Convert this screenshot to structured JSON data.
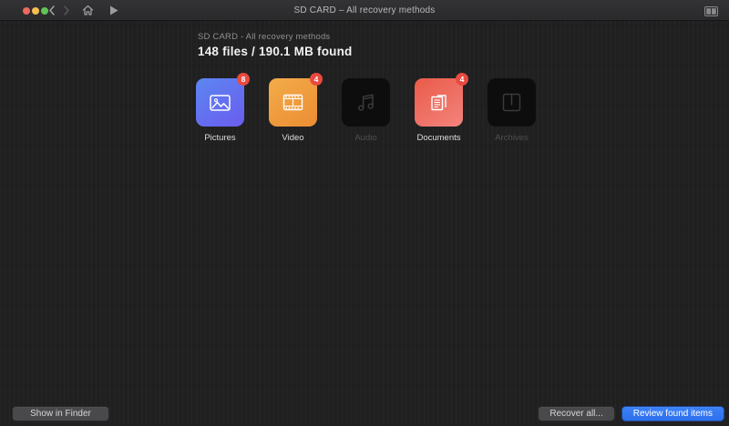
{
  "titlebar": {
    "title": "SD CARD – All recovery methods",
    "icons": [
      "traffic-light-close",
      "traffic-light-minimize",
      "traffic-light-zoom",
      "back-chevron",
      "forward-chevron",
      "home",
      "play",
      "panel-toggle"
    ]
  },
  "header": {
    "subtitle": "SD CARD - All recovery methods",
    "title": "148 files / 190.1 MB found"
  },
  "categories": [
    {
      "label": "Pictures",
      "badge": "8",
      "enabled": true,
      "icon": "pictures-icon",
      "color_top": "#5c86f1",
      "color_bottom": "#6a5def"
    },
    {
      "label": "Video",
      "badge": "4",
      "enabled": true,
      "icon": "film-icon",
      "color_top": "#f3ac49",
      "color_bottom": "#eb8d33"
    },
    {
      "label": "Audio",
      "badge": "",
      "enabled": false,
      "icon": "music-note-icon",
      "color_top": "#0d0d0e",
      "color_bottom": "#0d0d0e"
    },
    {
      "label": "Documents",
      "badge": "4",
      "enabled": true,
      "icon": "documents-icon",
      "color_top": "#e95b49",
      "color_bottom": "#f3837d"
    },
    {
      "label": "Archives",
      "badge": "",
      "enabled": false,
      "icon": "archive-box-icon",
      "color_top": "#0d0d0e",
      "color_bottom": "#0d0d0e"
    }
  ],
  "footer": {
    "show_in_finder": "Show in Finder",
    "recover_all": "Recover all...",
    "review_found_items": "Review found items"
  },
  "colors": {
    "badge_red": "#e94a3f",
    "accent_blue": "#3478f6",
    "background": "#202021",
    "titlebar": "#2e2e30"
  }
}
